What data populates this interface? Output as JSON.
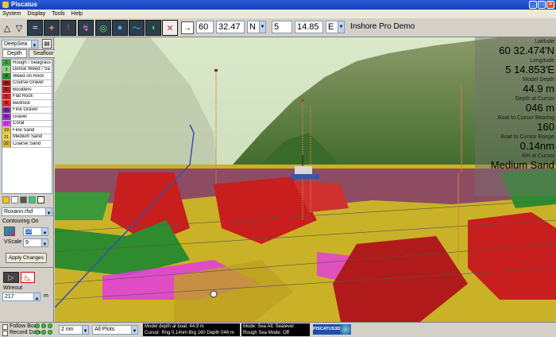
{
  "window": {
    "title": "Piscatus"
  },
  "menu": [
    "System",
    "Display",
    "Tools",
    "Help"
  ],
  "toolbar": {
    "lat_deg": "60",
    "lat_min": "32.47",
    "lat_hemi": "N",
    "lon_deg": "5",
    "lon_min": "14.85",
    "lon_hemi": "E",
    "mode": "Inshore Pro Demo",
    "icons": [
      "triangle-up-icon",
      "triangle-down-icon",
      "fish-icon",
      "compass-icon",
      "marker-icon",
      "route-icon",
      "globe-icon",
      "waves-icon",
      "depth-icon",
      "alarm-icon",
      "arrow-right-icon"
    ]
  },
  "left": {
    "palette": "DeepSea",
    "tab_depth": "Depth",
    "tab_seafloor": "Seafloor",
    "legend": [
      {
        "num": "1",
        "label": "Rough / Seagrass",
        "color": "#39a339"
      },
      {
        "num": "3",
        "label": "Dense Weed / Sa",
        "color": "#8fd37a"
      },
      {
        "num": "4",
        "label": "Weed on Rock",
        "color": "#2e8b2e"
      },
      {
        "num": "5",
        "label": "Course Gravel",
        "color": "#a01818"
      },
      {
        "num": "6",
        "label": "Boulders",
        "color": "#c01a1a"
      },
      {
        "num": "7",
        "label": "Flat Rock",
        "color": "#cc2222"
      },
      {
        "num": "8",
        "label": "Bedrock",
        "color": "#d42a2a"
      },
      {
        "num": "15",
        "label": "Fine Gravel",
        "color": "#8a2aa8"
      },
      {
        "num": "16",
        "label": "Gravel",
        "color": "#9b30c8"
      },
      {
        "num": "17",
        "label": "Coral",
        "color": "#ff33ff"
      },
      {
        "num": "19",
        "label": "Fine Sand",
        "color": "#e8c840"
      },
      {
        "num": "21",
        "label": "Medium Sand",
        "color": "#f0d830"
      },
      {
        "num": "22",
        "label": "Coarse Sand",
        "color": "#d8b830"
      }
    ],
    "file": "Roxann.rhd",
    "contouring_label": "Contouring On",
    "contour_value": "10",
    "vscale_label": "VScale",
    "vscale_value": "9",
    "apply_label": "Apply Changes",
    "wireout_label": "Wireout",
    "wireout_value": "217",
    "wireout_unit": "m"
  },
  "info": {
    "latitude_label": "Latitude",
    "latitude_value": "60 32.474'N",
    "longitude_label": "Longitude",
    "longitude_value": "5 14.853'E",
    "model_depth_label": "Model Depth",
    "model_depth_value": "44.9 m",
    "depth_cursor_label": "Depth at Cursor",
    "depth_cursor_value": "046 m",
    "bearing_label": "Boat to Cursor Bearing",
    "bearing_value": "160",
    "range_label": "Boat to Cursor Range",
    "range_value": "0.14nm",
    "rh_label": "RH at Cursor",
    "rh_value": "Medium Sand"
  },
  "status": {
    "follow_boat": "Follow Boat",
    "record_data": "Record Data",
    "range": "2 nm",
    "plots": "All Plots",
    "line1": "Model depth at boat: 44.9 m",
    "line2": "Cursor: Rng 0.14nm Brg 160 Depth 046 m",
    "line3": "Mode: Sea  Alt: Sealevel",
    "line4": "Rough Sea Mode: Off",
    "brand": "PISCATUS3D"
  }
}
